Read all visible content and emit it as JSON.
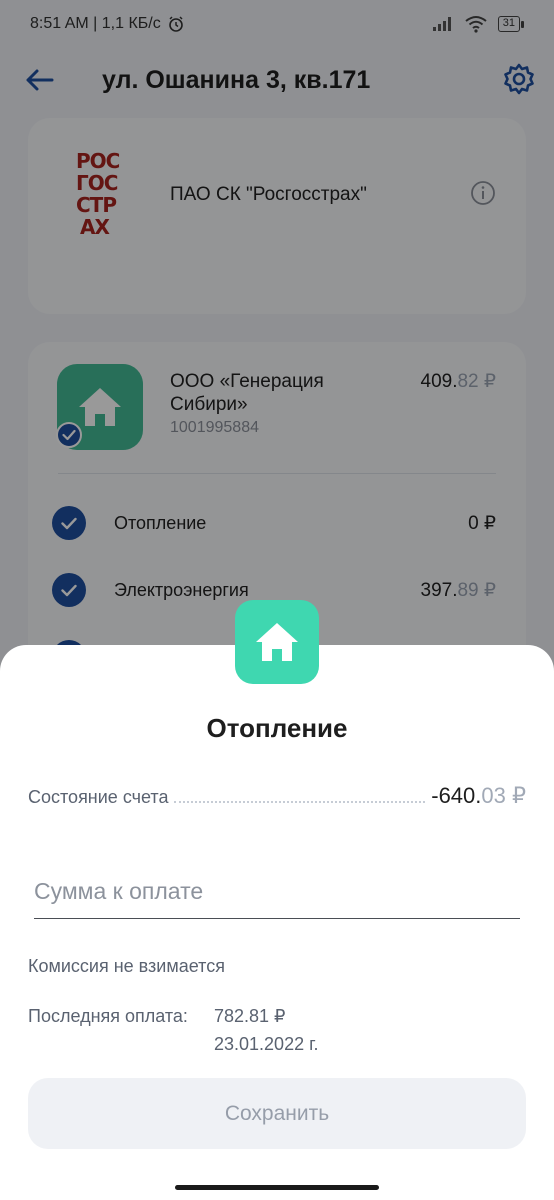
{
  "status_bar": {
    "time_info": "8:51 AM | 1,1 КБ/с",
    "battery": "31"
  },
  "header": {
    "title": "ул. Ошанина 3, кв.171"
  },
  "insurer": {
    "logo_text": "РОС ГОС СТР АХ",
    "name": "ПАО СК \"Росгосстрах\""
  },
  "provider": {
    "name": "ООО «Генерация Сибири»",
    "account": "1001995884",
    "amount_main": "409.",
    "amount_kop": "82 ₽",
    "services": [
      {
        "label": "Отопление",
        "amount_main": "0 ₽",
        "amount_kop": ""
      },
      {
        "label": "Электроэнергия",
        "amount_main": "397.",
        "amount_kop": "89 ₽"
      }
    ]
  },
  "sheet": {
    "title": "Отопление",
    "balance_label": "Состояние счета",
    "balance_main": "-640.",
    "balance_kop": "03 ₽",
    "input_placeholder": "Сумма к оплате",
    "input_value": "",
    "commission": "Комиссия не взимается",
    "last_payment_label": "Последняя оплата:",
    "last_payment_amount": "782.81 ₽",
    "last_payment_date": "23.01.2022 г.",
    "save_label": "Сохранить"
  },
  "colors": {
    "accent_blue": "#1f4f9f",
    "provider_green": "#44b994",
    "sheet_icon_teal": "#3fd7b0",
    "insurer_red": "#a7241f"
  }
}
